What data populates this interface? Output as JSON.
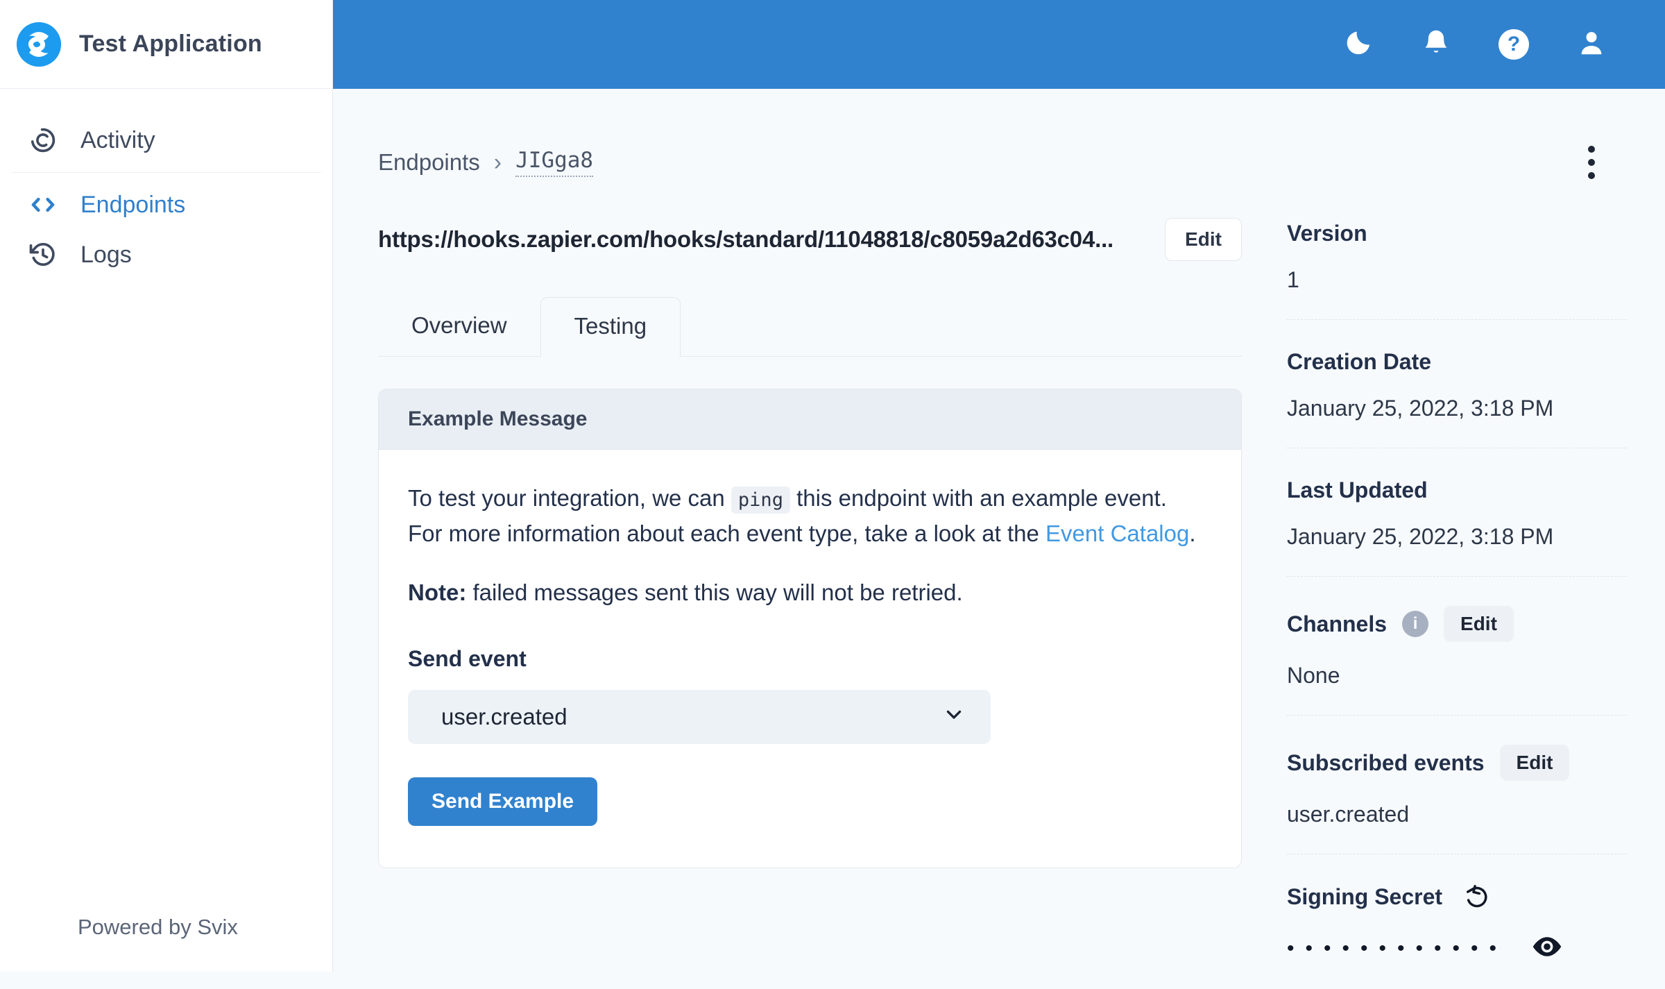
{
  "colors": {
    "accent": "#3182ce",
    "link": "#4299e1",
    "topbar": "#3182ce",
    "page_bg": "#f7fafc"
  },
  "app": {
    "title": "Test Application",
    "powered_by": "Powered by Svix"
  },
  "sidebar": {
    "items": [
      {
        "label": "Activity",
        "icon": "activity-gauge-icon",
        "active": false
      },
      {
        "label": "Endpoints",
        "icon": "code-brackets-icon",
        "active": true
      },
      {
        "label": "Logs",
        "icon": "history-clock-icon",
        "active": false
      }
    ]
  },
  "topbar": {
    "icons": [
      "dark-mode-moon",
      "notifications-bell",
      "help-question",
      "account-user"
    ]
  },
  "breadcrumb": {
    "parent": "Endpoints",
    "separator": "›",
    "current": "JIGga8"
  },
  "endpoint": {
    "url": "https://hooks.zapier.com/hooks/standard/11048818/c8059a2d63c04...",
    "edit_label": "Edit"
  },
  "tabs": [
    {
      "label": "Overview",
      "active": false
    },
    {
      "label": "Testing",
      "active": true
    }
  ],
  "card": {
    "title": "Example Message",
    "paragraph": {
      "text_1": "To test your integration, we can ",
      "code": "ping",
      "text_2": " this endpoint with an example event. For more information about each event type, take a look at the ",
      "link": "Event Catalog",
      "text_3": "."
    },
    "note_label": "Note:",
    "note_text": " failed messages sent this way will not be retried.",
    "send_event_label": "Send event",
    "select_value": "user.created",
    "send_button_label": "Send Example"
  },
  "details": {
    "version": {
      "label": "Version",
      "value": "1"
    },
    "creation_date": {
      "label": "Creation Date",
      "value": "January 25, 2022, 3:18 PM"
    },
    "last_updated": {
      "label": "Last Updated",
      "value": "January 25, 2022, 3:18 PM"
    },
    "channels": {
      "label": "Channels",
      "edit_label": "Edit",
      "value": "None"
    },
    "subscribed_events": {
      "label": "Subscribed events",
      "edit_label": "Edit",
      "value": "user.created"
    },
    "signing_secret": {
      "label": "Signing Secret",
      "masked_value": "••••••••••••"
    }
  }
}
